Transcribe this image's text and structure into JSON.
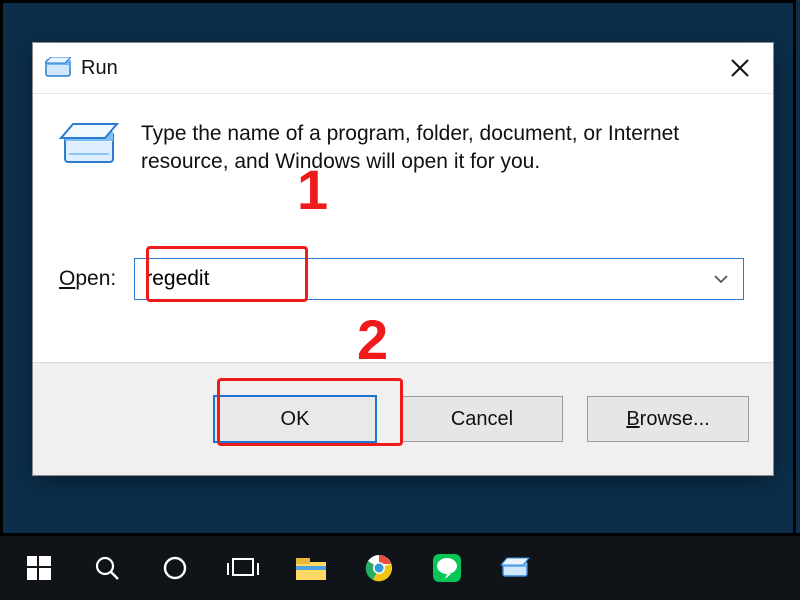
{
  "window": {
    "title": "Run",
    "description": "Type the name of a program, folder, document, or Internet resource, and Windows will open it for you.",
    "open_label_pre": "O",
    "open_label_rest": "pen:",
    "input_value": "regedit",
    "buttons": {
      "ok": "OK",
      "cancel": "Cancel",
      "browse_pre": "B",
      "browse_rest": "rowse..."
    }
  },
  "annotations": {
    "step1": "1",
    "step2": "2"
  },
  "taskbar": {
    "items": [
      "start-icon",
      "search-icon",
      "cortana-icon",
      "taskview-icon",
      "file-explorer-icon",
      "chrome-icon",
      "line-icon",
      "run-icon"
    ]
  }
}
